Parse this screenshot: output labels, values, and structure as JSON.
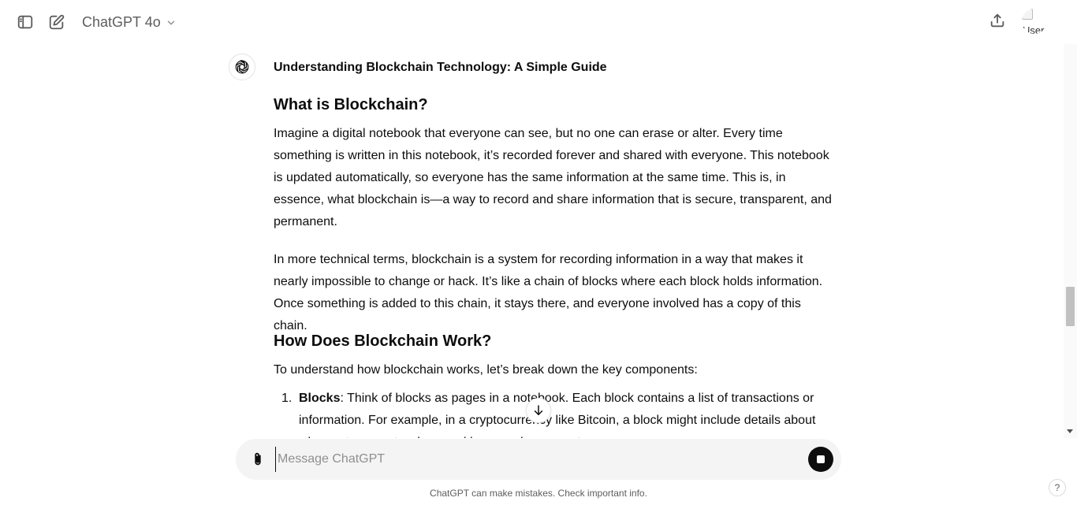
{
  "header": {
    "model_name": "ChatGPT 4o",
    "avatar_alt": "User"
  },
  "conversation": {
    "doc_title": "Understanding Blockchain Technology: A Simple Guide",
    "section1_heading": "What is Blockchain?",
    "section1_p1": "Imagine a digital notebook that everyone can see, but no one can erase or alter. Every time something is written in this notebook, it’s recorded forever and shared with everyone. This notebook is updated automatically, so everyone has the same information at the same time. This is, in essence, what blockchain is—a way to record and share information that is secure, transparent, and permanent.",
    "section1_p2": "In more technical terms, blockchain is a system for recording information in a way that makes it nearly impossible to change or hack. It’s like a chain of blocks where each block holds information. Once something is added to this chain, it stays there, and everyone involved has a copy of this chain.",
    "section2_heading": "How Does Blockchain Work?",
    "section2_intro": "To understand how blockchain works, let’s break down the key components:",
    "list": [
      {
        "number": "1.",
        "term": "Blocks",
        "text": ": Think of blocks as pages in a notebook. Each block contains a list of transactions or information. For example, in a cryptocurrency like Bitcoin, a block might include details about who sent money to whom and how much was sent."
      }
    ]
  },
  "composer": {
    "placeholder": "Message ChatGPT"
  },
  "footer": {
    "disclaimer": "ChatGPT can make mistakes. Check important info.",
    "help_label": "?"
  },
  "colors": {
    "text": "#0d0d0d",
    "muted": "#5d5d5d",
    "composer_bg": "#f4f4f4",
    "stop_button": "#0d0d0d"
  }
}
